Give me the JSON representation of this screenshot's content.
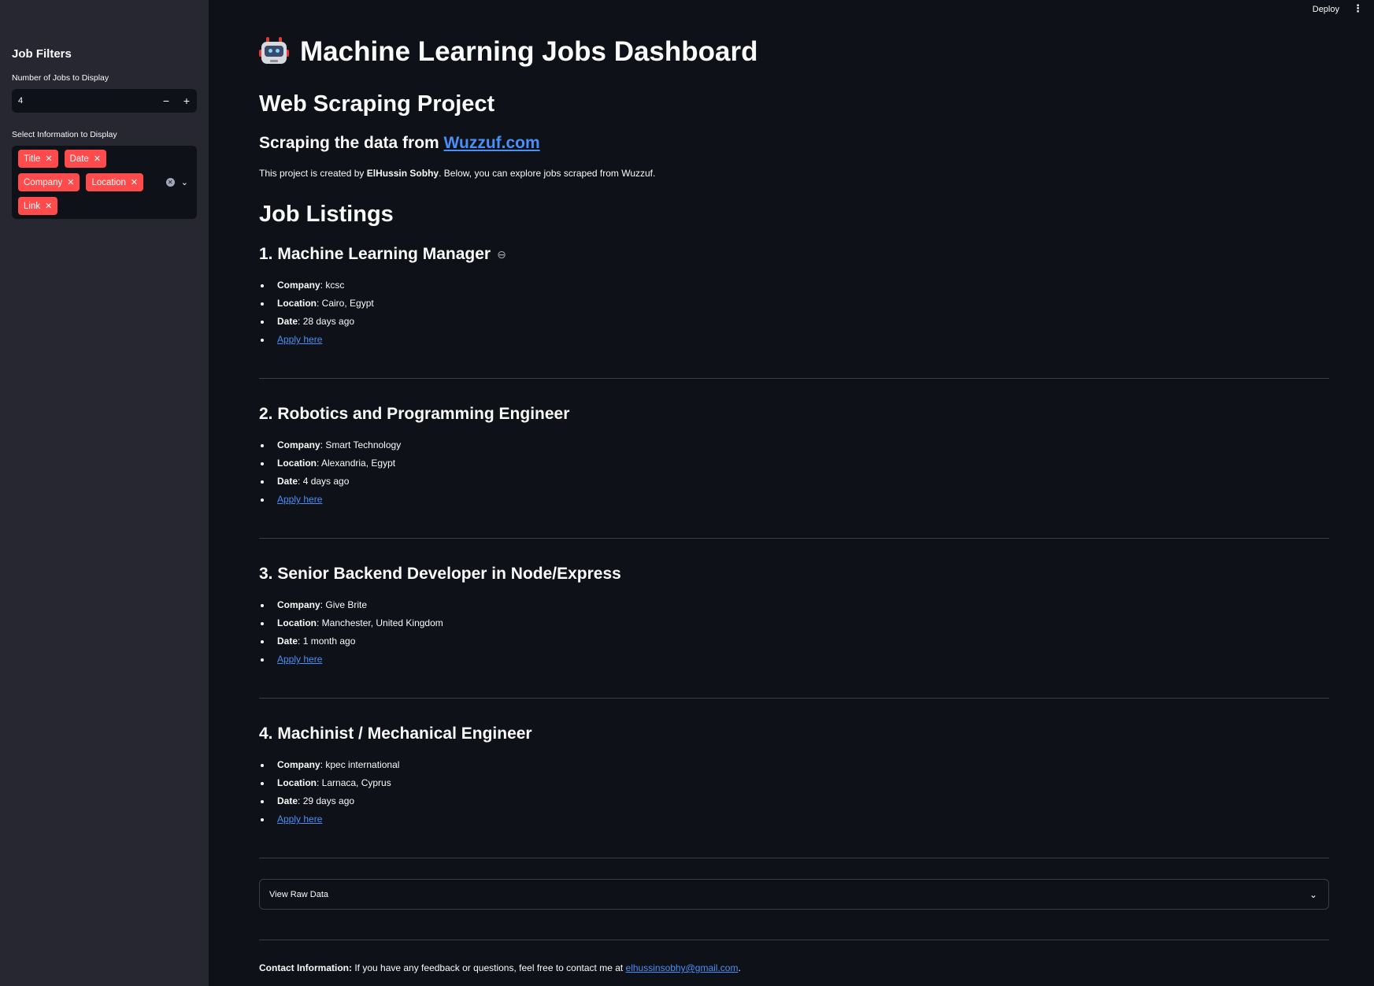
{
  "topbar": {
    "deploy_label": "Deploy",
    "menu_icon": "kebab-menu-icon"
  },
  "sidebar": {
    "title": "Job Filters",
    "jobs_count": {
      "label": "Number of Jobs to Display",
      "value": "4",
      "decrement": "−",
      "increment": "+"
    },
    "info_select": {
      "label": "Select Information to Display",
      "chips": [
        "Title",
        "Date",
        "Company",
        "Location",
        "Link"
      ]
    }
  },
  "main": {
    "title": "Machine Learning Jobs Dashboard",
    "subtitle": "Web Scraping Project",
    "scraping_prefix": "Scraping the data from ",
    "scraping_link": "Wuzzuf.com",
    "intro_prefix": "This project is created by ",
    "intro_author": "ElHussin Sobhy",
    "intro_suffix": ". Below, you can explore jobs scraped from Wuzzuf.",
    "listings_heading": "Job Listings",
    "field_labels": {
      "company": "Company",
      "location": "Location",
      "date": "Date"
    },
    "apply_label": "Apply here",
    "jobs": [
      {
        "title": "1. Machine Learning Manager",
        "company": "kcsc",
        "location": "Cairo, Egypt",
        "date": "28 days ago"
      },
      {
        "title": "2. Robotics and Programming Engineer",
        "company": "Smart Technology",
        "location": "Alexandria, Egypt",
        "date": "4 days ago"
      },
      {
        "title": "3. Senior Backend Developer in Node/Express",
        "company": "Give Brite",
        "location": "Manchester, United Kingdom",
        "date": "1 month ago"
      },
      {
        "title": "4. Machinist / Mechanical Engineer",
        "company": "kpec international",
        "location": "Larnaca, Cyprus",
        "date": "29 days ago"
      }
    ],
    "raw_data_label": "View Raw Data",
    "contact_label": "Contact Information:",
    "contact_text": " If you have any feedback or questions, feel free to contact me at ",
    "contact_email": "elhussinsobhy@gmail.com",
    "contact_end": "."
  },
  "colors": {
    "accent": "#ff4b4b",
    "link": "#4a8ff7",
    "background": "#0e1117",
    "sidebar": "#262730"
  }
}
